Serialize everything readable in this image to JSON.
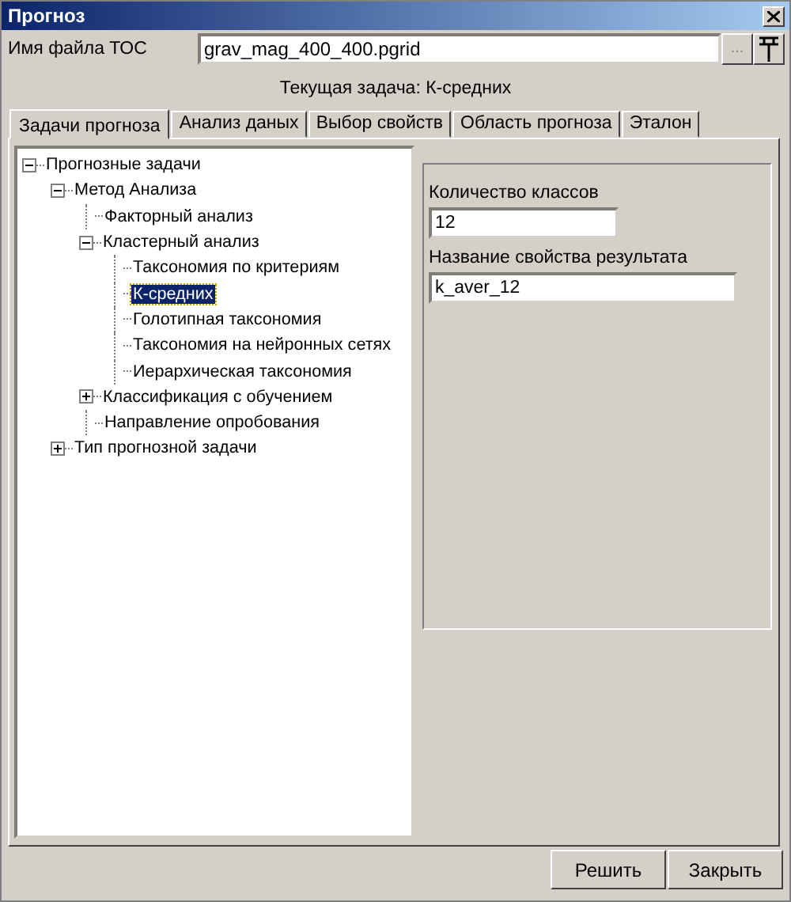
{
  "window": {
    "title": "Прогноз"
  },
  "toc_file": {
    "label": "Имя файла ТОС",
    "value": "grav_mag_400_400.pgrid",
    "browse_button": "..."
  },
  "current_task": "Текущая задача: К-средних",
  "tabs": [
    {
      "label": "Задачи прогноза",
      "selected": true
    },
    {
      "label": "Анализ даных",
      "selected": false
    },
    {
      "label": "Выбор свойств",
      "selected": false
    },
    {
      "label": "Область прогноза",
      "selected": false
    },
    {
      "label": "Эталон",
      "selected": false
    }
  ],
  "tree": [
    {
      "label": "Прогнозные задачи",
      "expanded": true,
      "selected": false,
      "children": [
        {
          "label": "Метод Анализа",
          "expanded": true,
          "selected": false,
          "children": [
            {
              "label": "Факторный анализ",
              "selected": false
            },
            {
              "label": "Кластерный анализ",
              "expanded": true,
              "selected": false,
              "children": [
                {
                  "label": "Таксономия по критериям",
                  "selected": false
                },
                {
                  "label": "К-средних",
                  "selected": true
                },
                {
                  "label": "Голотипная таксономия",
                  "selected": false
                },
                {
                  "label": "Таксономия на нейронных сетях",
                  "selected": false
                },
                {
                  "label": "Иерархическая таксономия",
                  "selected": false
                }
              ]
            },
            {
              "label": "Классификация с обучением",
              "expanded": false,
              "selected": false
            },
            {
              "label": "Направление опробования",
              "selected": false
            }
          ]
        },
        {
          "label": "Тип прогнозной задачи",
          "expanded": false,
          "selected": false
        }
      ]
    }
  ],
  "settings": {
    "fields": [
      {
        "label": "Количество классов",
        "value": "12"
      },
      {
        "label": "Название свойства результата",
        "value": "k_aver_12"
      }
    ]
  },
  "buttons": [
    "Решить",
    "Закрыть"
  ]
}
